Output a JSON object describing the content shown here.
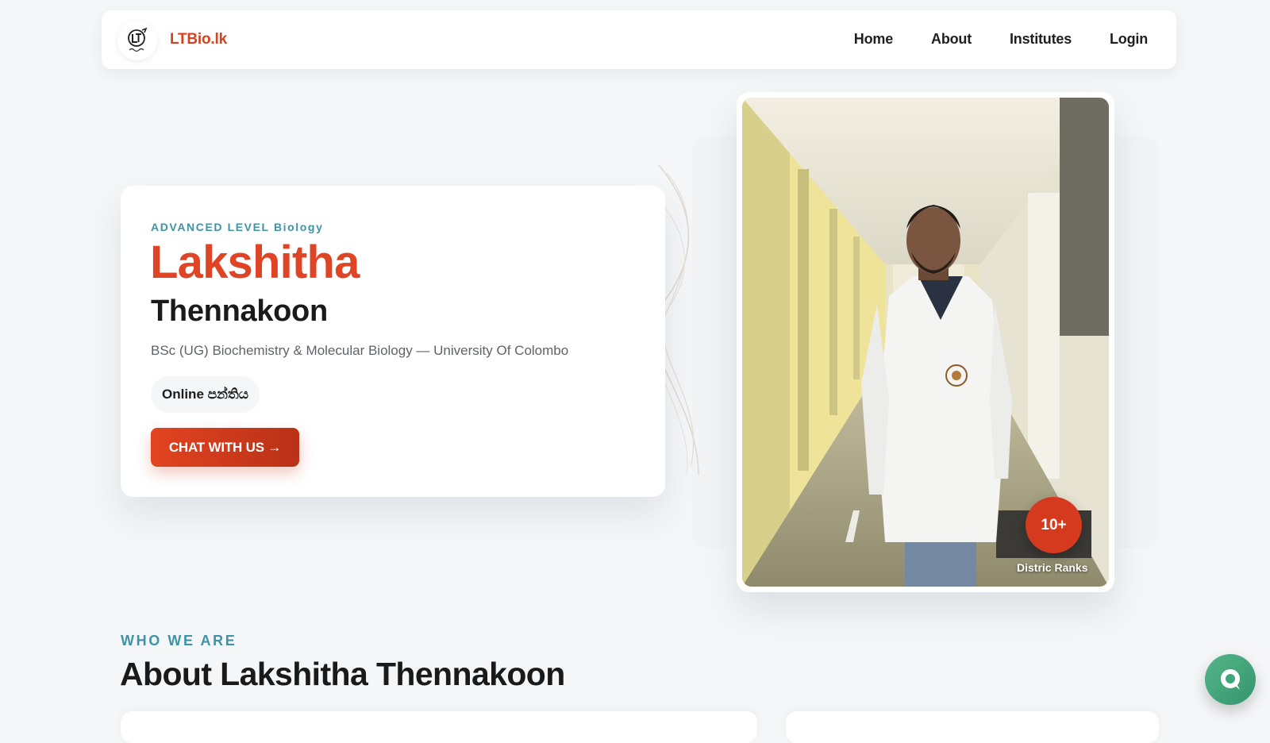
{
  "header": {
    "logo_icon": "lt-monogram-icon",
    "brand": "LTBio.lk",
    "nav": [
      {
        "label": "Home"
      },
      {
        "label": "About"
      },
      {
        "label": "Institutes"
      },
      {
        "label": "Login"
      }
    ]
  },
  "hero": {
    "eyebrow": "ADVANCED LEVEL Biology",
    "first_name": "Lakshitha",
    "last_name": "Thennakoon",
    "degree": "BSc (UG) Biochemistry & Molecular Biology — University Of Colombo",
    "pill": "Online පන්තිය",
    "cta": "CHAT WITH US →",
    "badge_value": "10+",
    "badge_label": "Distric Ranks"
  },
  "about": {
    "eyebrow": "WHO WE ARE",
    "title": "About Lakshitha Thennakoon"
  },
  "chat_widget": {
    "icon": "chat-bubble-icon"
  },
  "colors": {
    "accent": "#df4424",
    "teal": "#3e93a5",
    "chat_green": "#3fa57a"
  }
}
